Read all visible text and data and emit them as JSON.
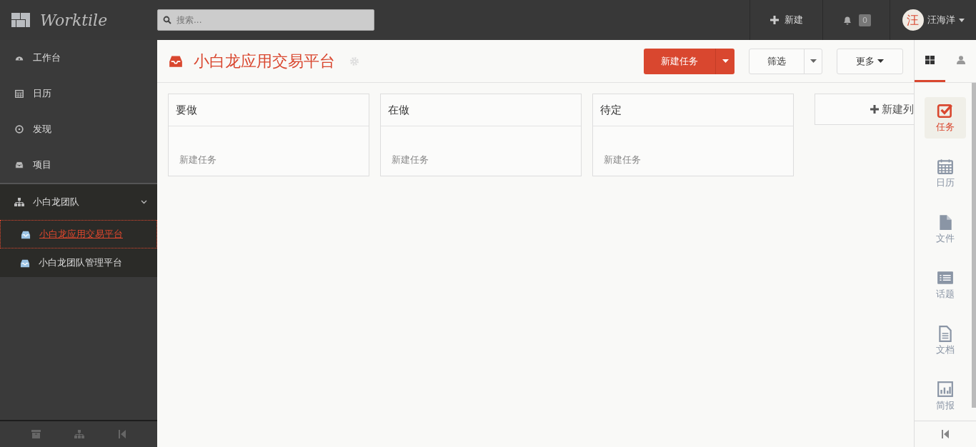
{
  "topbar": {
    "logo": "Worktile",
    "search": {
      "placeholder": "搜索..."
    },
    "new_label": "新建",
    "notifications": "0",
    "user": {
      "avatar": "汪",
      "name": "汪海洋"
    }
  },
  "sidebar": {
    "items": [
      {
        "label": "工作台",
        "selected": false
      },
      {
        "label": "日历",
        "selected": false
      },
      {
        "label": "发现",
        "selected": false
      },
      {
        "label": "项目",
        "selected": false
      }
    ],
    "team": {
      "label": "小白龙团队",
      "expanded": true,
      "projects": [
        {
          "label": "小白龙应用交易平台",
          "selected": true
        },
        {
          "label": "小白龙团队管理平台",
          "selected": false
        }
      ]
    }
  },
  "header": {
    "title": "小白龙应用交易平台",
    "new_task": "新建任务",
    "filter": "筛选",
    "more": "更多"
  },
  "lists": [
    {
      "title": "要做",
      "add": "新建任务"
    },
    {
      "title": "在做",
      "add": "新建任务"
    },
    {
      "title": "待定",
      "add": "新建任务"
    }
  ],
  "new_list": "新建列",
  "rail": {
    "tabs": [
      {
        "selected": true
      },
      {
        "selected": false
      }
    ],
    "items": [
      {
        "label": "任务",
        "selected": true
      },
      {
        "label": "日历",
        "selected": false
      },
      {
        "label": "文件",
        "selected": false
      },
      {
        "label": "话题",
        "selected": false
      },
      {
        "label": "文档",
        "selected": false
      },
      {
        "label": "简报",
        "selected": false
      }
    ]
  }
}
